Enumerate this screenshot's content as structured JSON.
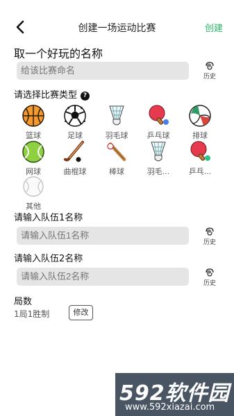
{
  "header": {
    "title": "创建一场运动比赛",
    "create_label": "创建"
  },
  "name_section": {
    "heading": "取一个好玩的名称",
    "placeholder": "给该比赛命名"
  },
  "history_label": "历史",
  "type_section": {
    "heading": "请选择比赛类型",
    "help_icon": "?"
  },
  "sports": [
    {
      "label": "篮球",
      "icon": "basketball-icon"
    },
    {
      "label": "足球",
      "icon": "soccer-ball-icon"
    },
    {
      "label": "羽毛球",
      "icon": "shuttlecock-icon"
    },
    {
      "label": "乒乓球",
      "icon": "ping-pong-icon"
    },
    {
      "label": "排球",
      "icon": "volleyball-icon"
    },
    {
      "label": "网球",
      "icon": "tennis-ball-icon"
    },
    {
      "label": "曲棍球",
      "icon": "hockey-stick-icon"
    },
    {
      "label": "棒球",
      "icon": "baseball-bat-icon"
    },
    {
      "label": "羽毛...",
      "icon": "shuttlecock-icon"
    },
    {
      "label": "乒乓...",
      "icon": "ping-pong-icon"
    },
    {
      "label": "其他",
      "icon": "other-ball-icon"
    }
  ],
  "team1": {
    "heading": "请输入队伍1名称",
    "placeholder": "请输入队伍1名称"
  },
  "team2": {
    "heading": "请输入队伍2名称",
    "placeholder": "请输入队伍2名称"
  },
  "rounds": {
    "heading": "局数",
    "value": "1局1胜制",
    "modify_label": "修改"
  },
  "watermark": {
    "brand": "592软件园",
    "url": "www.592xiazai.com"
  },
  "colors": {
    "accent": "#2db36a",
    "input_bg": "#e5e5e5",
    "watermark_bg": "#4a5564"
  }
}
